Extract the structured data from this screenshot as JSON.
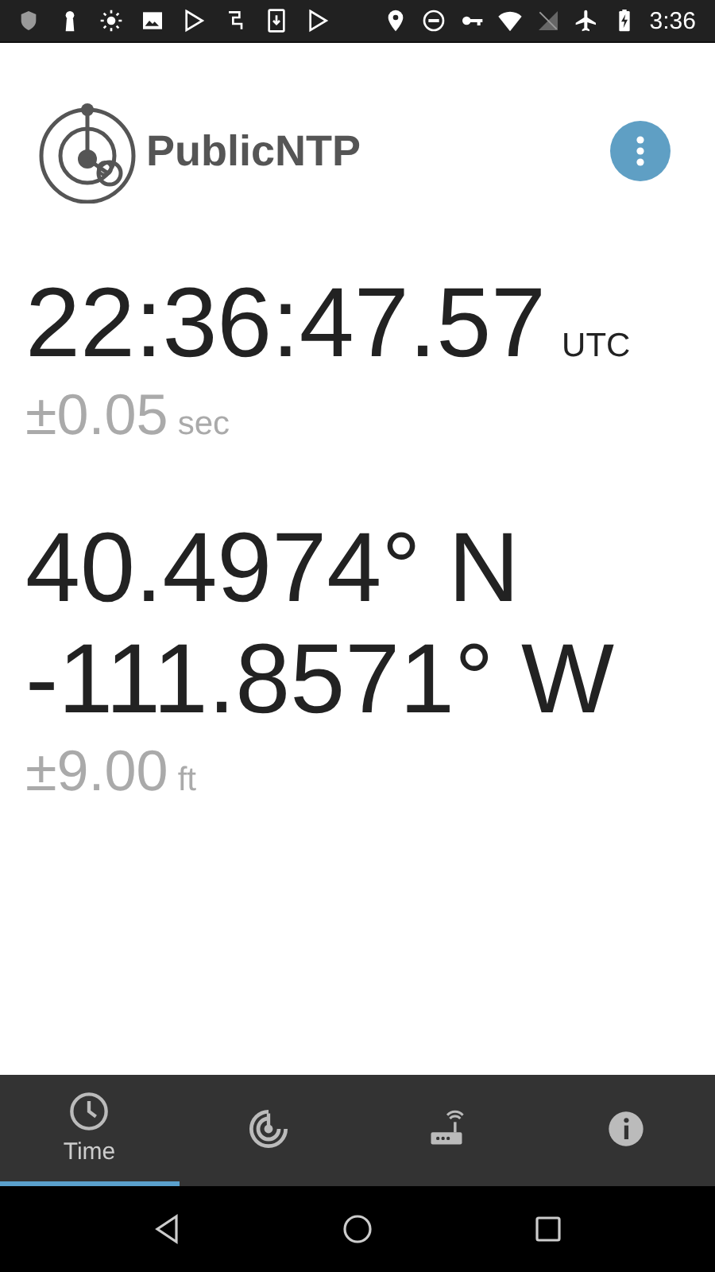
{
  "status_bar": {
    "time": "3:36"
  },
  "header": {
    "app_name": "PublicNTP"
  },
  "time": {
    "value": "22:36:47.57",
    "zone": "UTC",
    "accuracy": "±0.05",
    "accuracy_unit": "sec"
  },
  "location": {
    "latitude": "40.4974° N",
    "longitude": "-111.8571° W",
    "accuracy": "±9.00",
    "accuracy_unit": "ft"
  },
  "tabs": [
    {
      "kind": "clock",
      "label": "Time",
      "selected": true
    },
    {
      "kind": "radar",
      "selected": false
    },
    {
      "kind": "router",
      "selected": false
    },
    {
      "kind": "info",
      "selected": false
    }
  ]
}
